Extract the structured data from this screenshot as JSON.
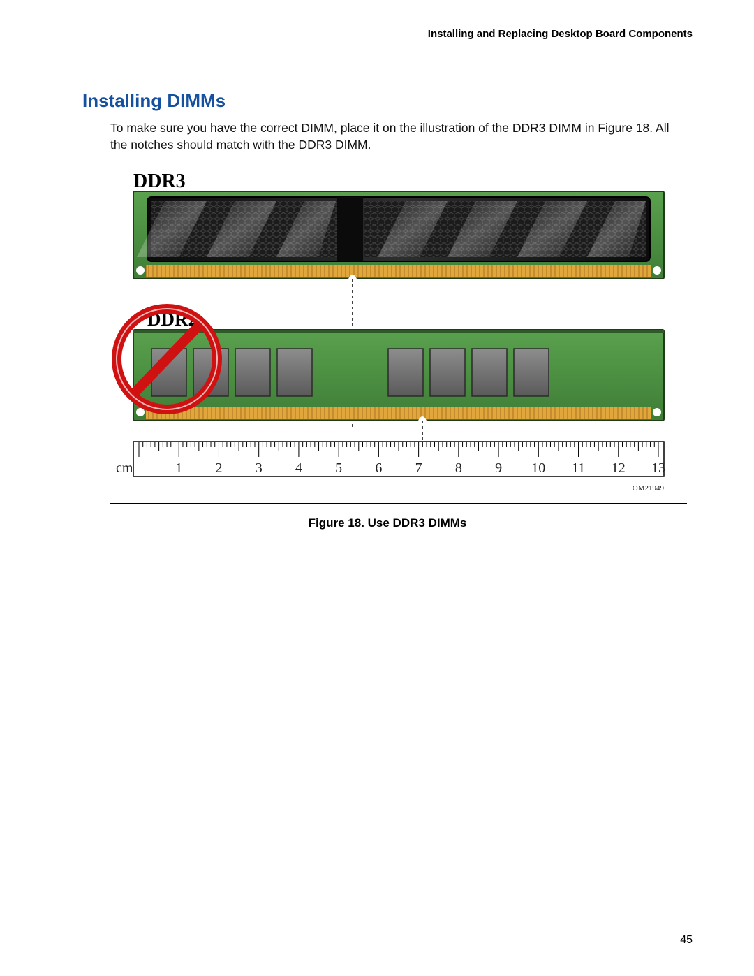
{
  "header": "Installing and Replacing Desktop Board Components",
  "section_title": "Installing DIMMs",
  "paragraph": "To make sure you have the correct DIMM, place it on the illustration of the DDR3 DIMM in Figure 18.  All the notches should match with the DDR3 DIMM.",
  "figure": {
    "ddr3_label": "DDR3",
    "ddr2_label": "DDR2",
    "ruler_unit": "cm",
    "ruler_numbers": [
      "1",
      "2",
      "3",
      "4",
      "5",
      "6",
      "7",
      "8",
      "9",
      "10",
      "11",
      "12",
      "13"
    ],
    "image_code": "OM21949",
    "caption": "Figure 18.  Use DDR3 DIMMs"
  },
  "page_number": "45"
}
